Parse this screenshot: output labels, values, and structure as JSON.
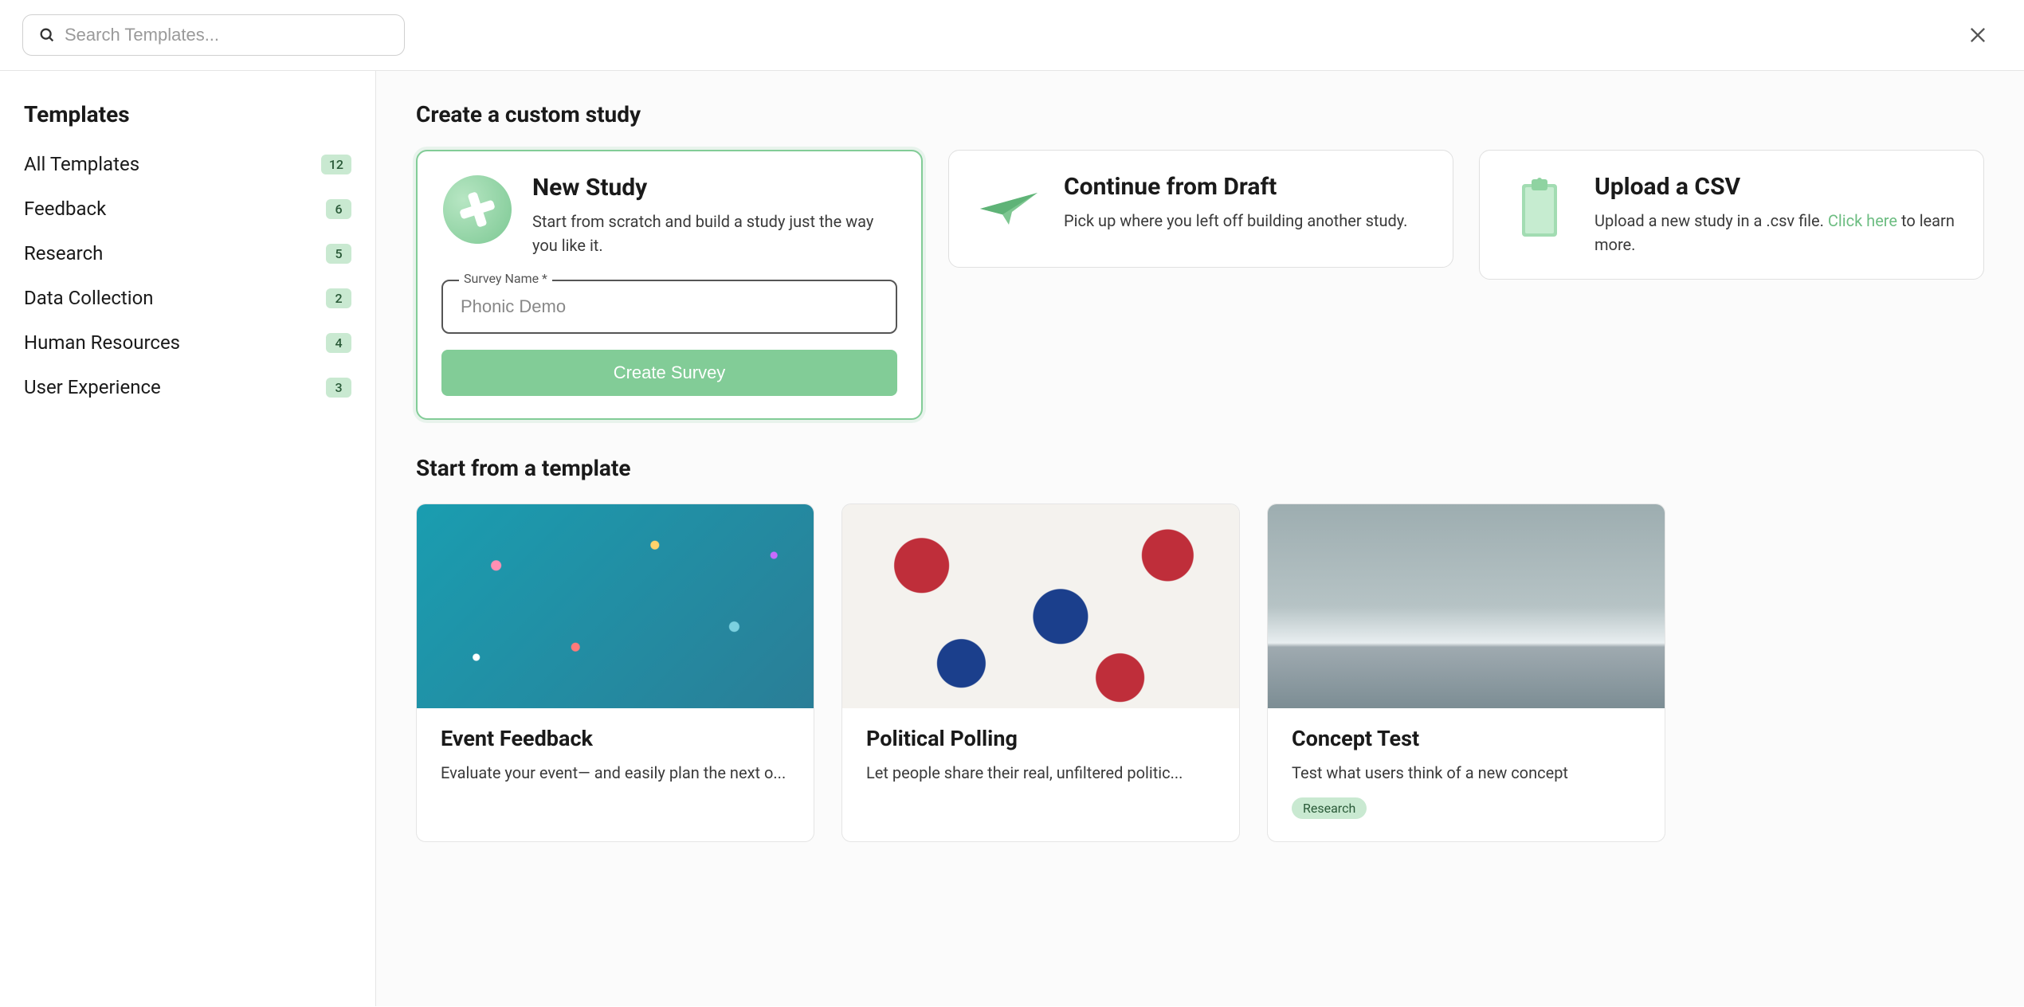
{
  "search": {
    "placeholder": "Search Templates..."
  },
  "sidebar": {
    "title": "Templates",
    "items": [
      {
        "label": "All Templates",
        "count": "12"
      },
      {
        "label": "Feedback",
        "count": "6"
      },
      {
        "label": "Research",
        "count": "5"
      },
      {
        "label": "Data Collection",
        "count": "2"
      },
      {
        "label": "Human Resources",
        "count": "4"
      },
      {
        "label": "User Experience",
        "count": "3"
      }
    ]
  },
  "main": {
    "create_section_title": "Create a custom study",
    "new_study": {
      "title": "New Study",
      "desc": "Start from scratch and build a study just the way you like it.",
      "field_label": "Survey Name *",
      "field_placeholder": "Phonic Demo",
      "button_label": "Create Survey"
    },
    "continue_draft": {
      "title": "Continue from Draft",
      "desc": "Pick up where you left off building another study."
    },
    "upload_csv": {
      "title": "Upload a CSV",
      "desc_prefix": "Upload a new study in a .csv file. ",
      "link_text": "Click here",
      "desc_suffix": " to learn more."
    },
    "templates_section_title": "Start from a template",
    "templates": [
      {
        "title": "Event Feedback",
        "desc": "Evaluate your event— and easily plan the next o..."
      },
      {
        "title": "Political Polling",
        "desc": "Let people share their real, unfiltered politic..."
      },
      {
        "title": "Concept Test",
        "desc": "Test what users think of a new concept",
        "tag": "Research"
      }
    ]
  }
}
